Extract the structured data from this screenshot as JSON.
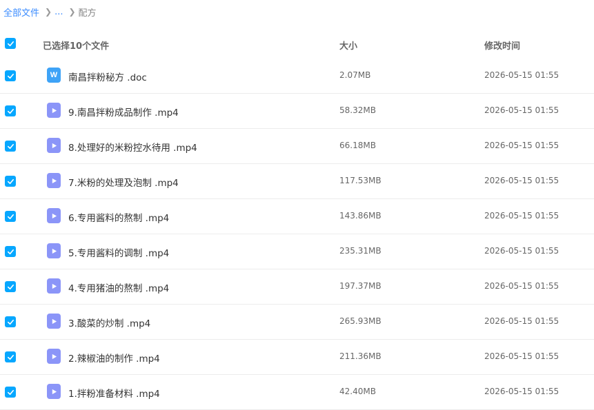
{
  "breadcrumb": {
    "root": "全部文件",
    "ellipsis": "...",
    "current": "配方"
  },
  "header": {
    "selected_label": "已选择10个文件",
    "size_label": "大小",
    "time_label": "修改时间"
  },
  "colors": {
    "accent": "#06a7ff",
    "link": "#3b8cff",
    "video_icon": "#8b95f8",
    "doc_icon": "#3ea3f7"
  },
  "files": [
    {
      "name": "南昌拌粉秘方 .doc",
      "size": "2.07MB",
      "time": "2026-05-15 01:55",
      "type": "doc",
      "icon_letter": "W",
      "checked": true
    },
    {
      "name": "9.南昌拌粉成品制作 .mp4",
      "size": "58.32MB",
      "time": "2026-05-15 01:55",
      "type": "mp4",
      "checked": true
    },
    {
      "name": "8.处理好的米粉控水待用 .mp4",
      "size": "66.18MB",
      "time": "2026-05-15 01:55",
      "type": "mp4",
      "checked": true
    },
    {
      "name": "7.米粉的处理及泡制 .mp4",
      "size": "117.53MB",
      "time": "2026-05-15 01:55",
      "type": "mp4",
      "checked": true
    },
    {
      "name": "6.专用酱料的熬制 .mp4",
      "size": "143.86MB",
      "time": "2026-05-15 01:55",
      "type": "mp4",
      "checked": true
    },
    {
      "name": "5.专用酱料的调制 .mp4",
      "size": "235.31MB",
      "time": "2026-05-15 01:55",
      "type": "mp4",
      "checked": true
    },
    {
      "name": "4.专用猪油的熬制 .mp4",
      "size": "197.37MB",
      "time": "2026-05-15 01:55",
      "type": "mp4",
      "checked": true
    },
    {
      "name": "3.酸菜的炒制 .mp4",
      "size": "265.93MB",
      "time": "2026-05-15 01:55",
      "type": "mp4",
      "checked": true
    },
    {
      "name": "2.辣椒油的制作 .mp4",
      "size": "211.36MB",
      "time": "2026-05-15 01:55",
      "type": "mp4",
      "checked": true
    },
    {
      "name": "1.拌粉准备材料 .mp4",
      "size": "42.40MB",
      "time": "2026-05-15 01:55",
      "type": "mp4",
      "checked": true
    }
  ]
}
